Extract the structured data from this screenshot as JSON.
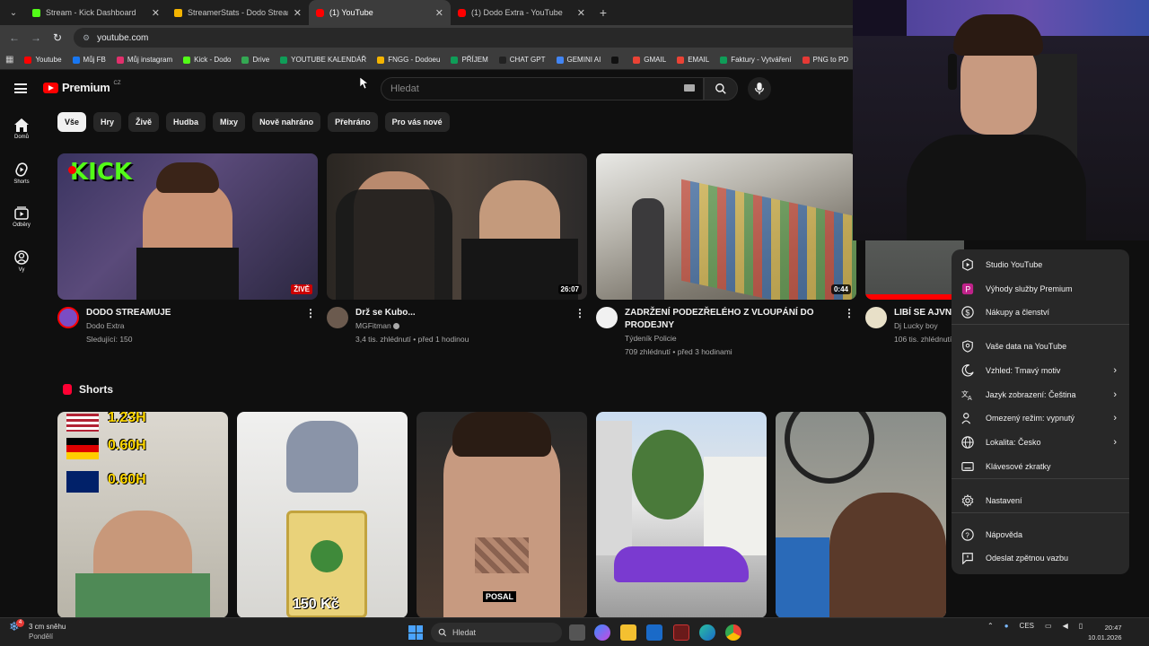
{
  "browser": {
    "tabs": [
      {
        "title": "Stream - Kick Dashboard",
        "color": "#53fc18"
      },
      {
        "title": "StreamerStats - Dodo Stream B",
        "color": "#f4b400"
      },
      {
        "title": "(1) YouTube",
        "color": "#ff0000",
        "active": true
      },
      {
        "title": "(1) Dodo Extra - YouTube",
        "color": "#ff0000"
      }
    ],
    "url": "youtube.com",
    "bookmarks": [
      {
        "label": "Youtube",
        "color": "#ff0000"
      },
      {
        "label": "Můj FB",
        "color": "#1877f2"
      },
      {
        "label": "Můj instagram",
        "color": "#e1306c"
      },
      {
        "label": "Kick - Dodo",
        "color": "#53fc18"
      },
      {
        "label": "Drive",
        "color": "#34a853"
      },
      {
        "label": "YOUTUBE KALENDÁŘ",
        "color": "#0f9d58"
      },
      {
        "label": "FNGG - Dodoeu",
        "color": "#f4b400"
      },
      {
        "label": "PŘÍJEM",
        "color": "#0f9d58"
      },
      {
        "label": "CHAT GPT",
        "color": "#222222"
      },
      {
        "label": "GEMINI AI",
        "color": "#4285f4"
      },
      {
        "label": "",
        "color": "#111111"
      },
      {
        "label": "GMAIL",
        "color": "#ea4335"
      },
      {
        "label": "EMAIL",
        "color": "#ea4335"
      },
      {
        "label": "Faktury - Vytváření",
        "color": "#0f9d58"
      },
      {
        "label": "PNG to PD",
        "color": "#e53935"
      }
    ]
  },
  "youtube": {
    "logo_text": "Premium",
    "logo_region": "CZ",
    "search_placeholder": "Hledat",
    "sidebar": [
      {
        "label": "Domů",
        "icon": "home-icon"
      },
      {
        "label": "Shorts",
        "icon": "shorts-icon"
      },
      {
        "label": "Odběry",
        "icon": "subscriptions-icon"
      },
      {
        "label": "Vy",
        "icon": "account-icon"
      }
    ],
    "chips": [
      "Vše",
      "Hry",
      "Živě",
      "Hudba",
      "Mixy",
      "Nově nahráno",
      "Přehráno",
      "Pro vás nové"
    ],
    "videos": [
      {
        "title": "DODO STREAMUJE",
        "channel": "Dodo Extra",
        "meta": "Sledující: 150",
        "badge": "ŽIVĚ",
        "avatar_label": "ŽIVĚ"
      },
      {
        "title": "Drž se Kubo...",
        "channel": "MGFitman",
        "meta": "3,4 tis. zhlédnutí • před 1 hodinou",
        "duration": "26:07"
      },
      {
        "title": "ZADRŽENÍ PODEZŘELÉHO Z VLOUPÁNÍ DO PRODEJNY",
        "channel": "Týdeník Policie",
        "meta": "709 zhlédnutí • před 3 hodinami",
        "duration": "0:44"
      },
      {
        "title": "LIBÍ SE AJVN",
        "channel": "Dj Lucky boy",
        "meta": "106 tis. zhlédnutí"
      }
    ],
    "shorts_title": "Shorts",
    "short_texts": {
      "s1_lines": [
        "1.23H",
        "0.60H",
        "0.60H"
      ],
      "s2_price": "150 Kč",
      "s3_caption": "POSAL"
    },
    "menu": [
      {
        "label": "Studio YouTube",
        "icon": "studio-icon"
      },
      {
        "label": "Výhody služby Premium",
        "icon": "premium-icon"
      },
      {
        "label": "Nákupy a členství",
        "icon": "dollar-icon"
      },
      {
        "label": "Vaše data na YouTube",
        "icon": "shield-icon"
      },
      {
        "label": "Vzhled: Tmavý motiv",
        "icon": "moon-icon",
        "chevron": true
      },
      {
        "label": "Jazyk zobrazení: Čeština",
        "icon": "translate-icon",
        "chevron": true
      },
      {
        "label": "Omezený režim: vypnutý",
        "icon": "person-lock-icon",
        "chevron": true
      },
      {
        "label": "Lokalita: Česko",
        "icon": "globe-icon",
        "chevron": true
      },
      {
        "label": "Klávesové zkratky",
        "icon": "keyboard-icon"
      },
      {
        "label": "Nastavení",
        "icon": "gear-icon"
      },
      {
        "label": "Nápověda",
        "icon": "help-icon"
      },
      {
        "label": "Odeslat zpětnou vazbu",
        "icon": "feedback-icon"
      }
    ]
  },
  "taskbar": {
    "weather_line1": "3 cm sněhu",
    "weather_line2": "Pondělí",
    "weather_badge": "4",
    "search_placeholder": "Hledat",
    "language": "CES",
    "time": "20:47",
    "date": "10.01.2026"
  }
}
